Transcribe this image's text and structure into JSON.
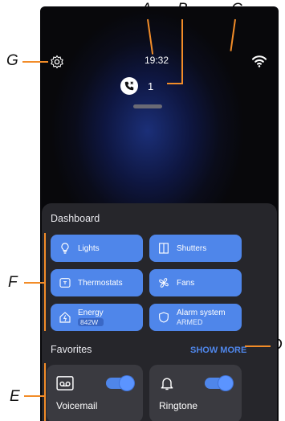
{
  "callouts": {
    "a": "A",
    "b": "B",
    "c": "C",
    "d": "D",
    "e": "E",
    "f": "F",
    "g": "G"
  },
  "status": {
    "time": "19:32",
    "missed_calls": "1"
  },
  "dashboard": {
    "title": "Dashboard",
    "tiles": [
      {
        "label": "Lights",
        "icon": "bulb-icon"
      },
      {
        "label": "Shutters",
        "icon": "shutter-icon"
      },
      {
        "label": "Thermostats",
        "icon": "thermostat-icon"
      },
      {
        "label": "Fans",
        "icon": "fan-icon"
      },
      {
        "label": "Energy",
        "sub": "842W",
        "icon": "energy-home-icon"
      },
      {
        "label": "Alarm system",
        "sub": "ARMED",
        "icon": "shield-icon"
      }
    ]
  },
  "favorites": {
    "title": "Favorites",
    "show_more": "SHOW MORE",
    "items": [
      {
        "label": "Voicemail",
        "icon": "voicemail-icon",
        "on": true
      },
      {
        "label": "Ringtone",
        "icon": "bell-icon",
        "on": true
      }
    ]
  },
  "colors": {
    "accent": "#4f86ea",
    "callout": "#f28c28",
    "panel": "#26262b",
    "card": "#3a3a40"
  }
}
